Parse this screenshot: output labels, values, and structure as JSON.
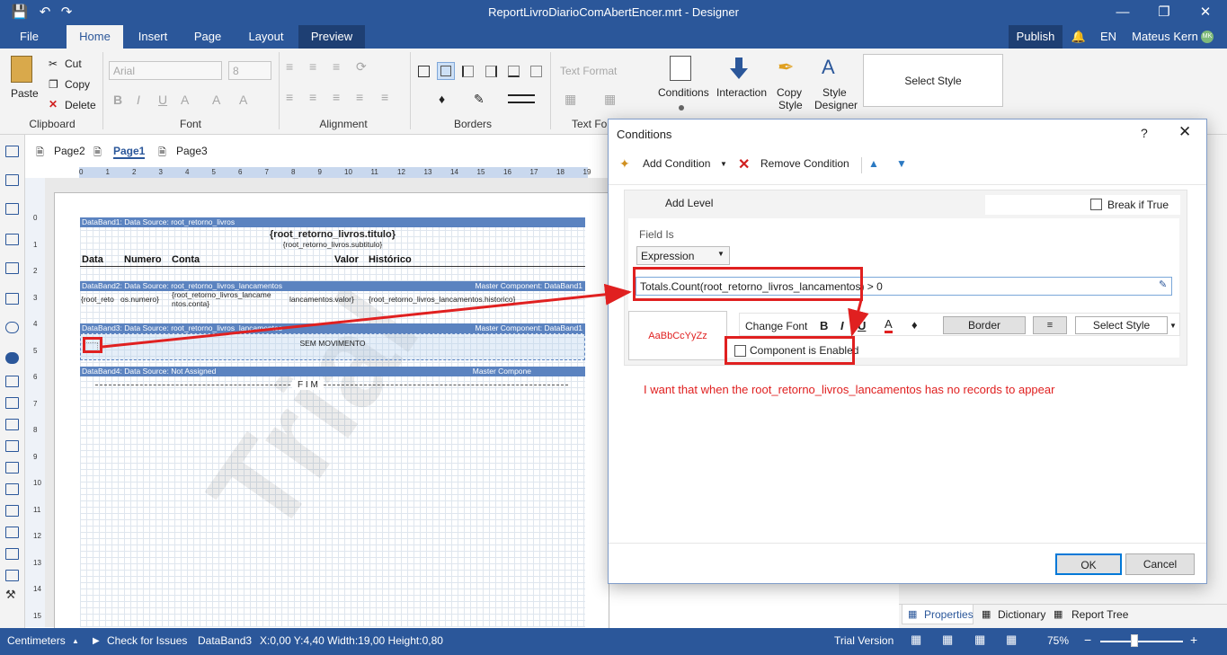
{
  "window": {
    "title": "ReportLivroDiarioComAbertEncer.mrt - Designer"
  },
  "menu": {
    "file": "File",
    "tabs": [
      "Home",
      "Insert",
      "Page",
      "Layout",
      "Preview"
    ],
    "publish": "Publish",
    "language": "EN",
    "user": "Mateus Kern",
    "user_initials": "MK"
  },
  "ribbon": {
    "clipboard": {
      "paste": "Paste",
      "cut": "Cut",
      "copy": "Copy",
      "delete": "Delete",
      "group": "Clipboard"
    },
    "font": {
      "family": "Arial",
      "size": "8",
      "group": "Font"
    },
    "alignment": {
      "group": "Alignment"
    },
    "borders": {
      "group": "Borders"
    },
    "text_format": {
      "label": "Text Format",
      "group": "Text For"
    },
    "conditions": "Conditions",
    "interaction": "Interaction",
    "copy_style": [
      "Copy",
      "Style"
    ],
    "style_designer": [
      "Style",
      "Designer"
    ],
    "select_style": "Select Style"
  },
  "page_tabs": [
    "Page2",
    "Page1",
    "Page3"
  ],
  "ruler": {
    "h": [
      "0",
      "1",
      "2",
      "3",
      "4",
      "5",
      "6",
      "7",
      "8",
      "9",
      "10",
      "11",
      "12",
      "13",
      "14",
      "15",
      "16",
      "17",
      "18",
      "19"
    ],
    "v": [
      "0",
      "1",
      "2",
      "3",
      "4",
      "5",
      "6",
      "7",
      "8",
      "9",
      "10",
      "11",
      "12",
      "13",
      "14",
      "15"
    ]
  },
  "report": {
    "band1": "DataBand1: Data Source: root_retorno_livros",
    "titulo": "{root_retorno_livros.titulo}",
    "subtitulo": "{root_retorno_livros.subtitulo}",
    "headers": [
      "Data",
      "Numero",
      "Conta",
      "Valor",
      "Histórico"
    ],
    "band2": "DataBand2: Data Source: root_retorno_livros_lancamentos",
    "band2_master": "Master Component: DataBand1",
    "cells": [
      "{root_reto",
      "os.numero}",
      "{root_retorno_livros_lancame",
      "ntos.conta}",
      "lancamentos.valor}",
      "{root_retorno_livros_lancamentos.historico}"
    ],
    "band3": "DataBand3: Data Source: root_retorno_livros_lancamentos",
    "band3_master": "Master Component: DataBand1",
    "sem": "SEM MOVIMENTO",
    "band4": "DataBand4: Data Source: Not Assigned",
    "band4_master": "Master Compone",
    "fim": "F I M",
    "watermark": "Trial"
  },
  "dialog": {
    "title": "Conditions",
    "help": "?",
    "add_condition": "Add Condition",
    "remove_condition": "Remove Condition",
    "add_level": "Add Level",
    "break_if_true": "Break if True",
    "field_is": "Field Is",
    "field_value": "Expression",
    "expression": "Totals.Count(root_retorno_livros_lancamentos) > 0",
    "sample": "AaBbCcYyZz",
    "change_font": "Change Font",
    "border": "Border",
    "select_style": "Select Style",
    "component_enabled": "Component is Enabled",
    "note": "I want that when the root_retorno_livros_lancamentos has no records to appear",
    "ok": "OK",
    "cancel": "Cancel"
  },
  "right_tabs": [
    "Properties",
    "Dictionary",
    "Report Tree"
  ],
  "status": {
    "units": "Centimeters",
    "check": "Check for Issues",
    "selected": "DataBand3",
    "coords": "X:0,00  Y:4,40  Width:19,00  Height:0,80",
    "trial": "Trial Version",
    "zoom": "75%"
  },
  "colors": {
    "accent": "#2b579a",
    "annotation": "#e02020",
    "band": "#5b83c0"
  }
}
